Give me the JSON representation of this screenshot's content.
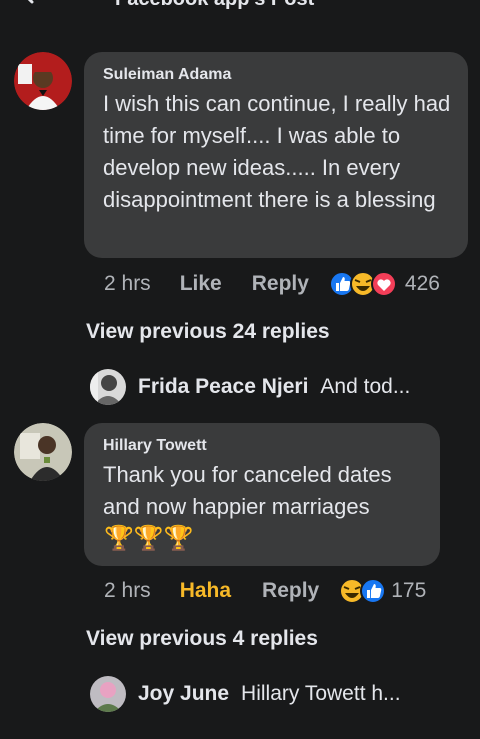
{
  "header": {
    "title": "Facebook app's Post"
  },
  "comments": [
    {
      "author": "Suleiman Adama",
      "text": "I wish this can continue, I really had time for myself.... I was able to develop new ideas..... In every disappointment there is a blessing",
      "time": "2 hrs",
      "like_label": "Like",
      "reply_label": "Reply",
      "reaction_count": "426",
      "reactions": [
        "like-icon",
        "haha-icon",
        "love-icon"
      ]
    },
    {
      "author": "Hillary Towett",
      "text": "Thank you for canceled dates and now happier marriages",
      "emoji": "🏆🏆🏆",
      "time": "2 hrs",
      "like_label": "Haha",
      "reply_label": "Reply",
      "reaction_count": "175",
      "reactions": [
        "haha-icon",
        "like-icon"
      ]
    }
  ],
  "replies": [
    {
      "view_previous": "View previous 24 replies",
      "preview_author": "Frida Peace Njeri",
      "preview_text": "And tod..."
    },
    {
      "view_previous": "View previous 4 replies",
      "preview_author": "Joy June",
      "preview_text": "Hillary Towett  h..."
    }
  ],
  "colors": {
    "background": "#18191a",
    "bubble": "#3a3b3c",
    "haha_active": "#f7b928",
    "like_blue": "#1877f2",
    "love_red": "#f33e58"
  }
}
